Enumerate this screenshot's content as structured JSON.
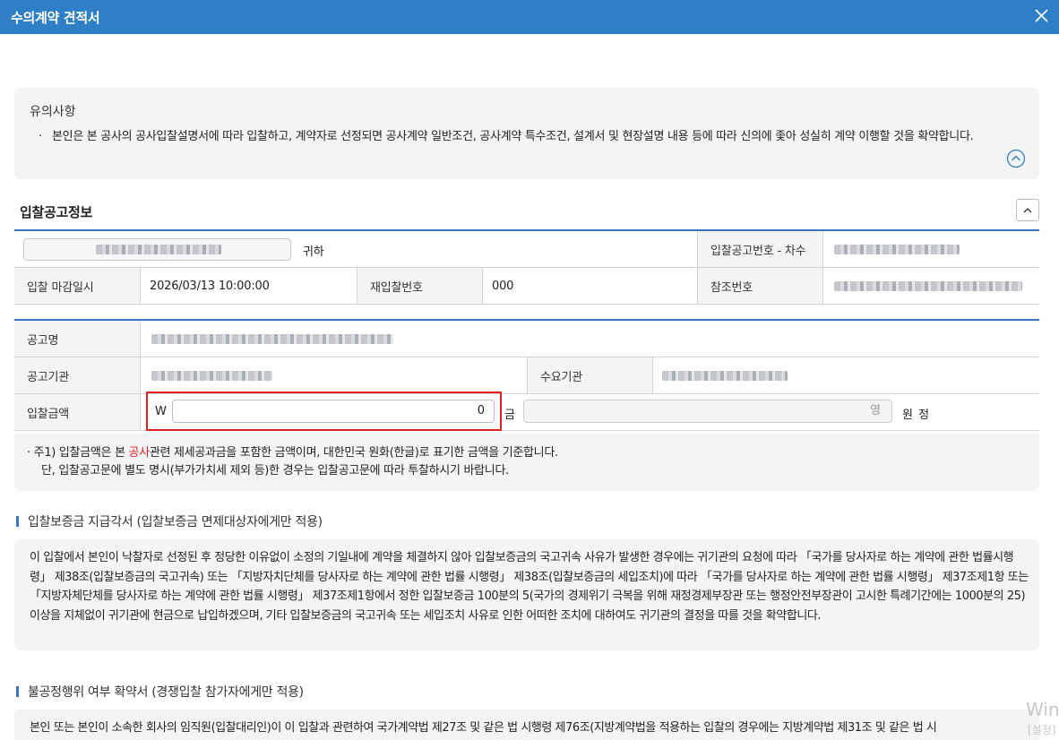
{
  "window": {
    "title": "수의계약 견적서",
    "close_icon": "close-icon"
  },
  "notice": {
    "title": "유의사항",
    "bullet": "·",
    "body": "본인은 본 공사의 공사입찰설명서에 따라 입찰하고, 계약자로 선정되면 공사계약 일반조건, 공사계약 특수조건, 설계서 및 현장설명 내용 등에 따라 신의에 좇아 성실히 계약 이행할 것을 확약합니다.",
    "toggle_icon": "chevron-up-circle-icon"
  },
  "bid_info": {
    "section_title": "입찰공고정보",
    "collapse_icon": "chevron-up-icon",
    "recipient_suffix": "귀하",
    "notice_number_label": "입찰공고번호 - 차수",
    "deadline_label": "입찰 마감일시",
    "deadline_value": "2026/03/13 10:00:00",
    "rebid_label": "재입찰번호",
    "rebid_value": "000",
    "ref_label": "참조번호"
  },
  "bid_form": {
    "name_label": "공고명",
    "agency_label": "공고기관",
    "demand_agency_label": "수요기관",
    "amount_label": "입찰금액",
    "currency_symbol": "W",
    "amount_value": "0",
    "korean_prefix": "금",
    "korean_value": "영",
    "korean_suffix": "원 정"
  },
  "note": {
    "line1_prefix": "· 주1) 입찰금액은 본 ",
    "line1_highlight": "공사",
    "line1_suffix": "관련 제세공과금을 포함한 금액이며, 대한민국 원화(한글)로 표기한 금액을 기준합니다.",
    "line2": "단, 입찰공고문에 별도 명시(부가가치세 제외 등)한 경우는 입찰공고문에 따라 투찰하시기 바랍니다."
  },
  "guarantee": {
    "title": "입찰보증금 지급각서 (입찰보증금 면제대상자에게만 적용)",
    "body": "이 입찰에서 본인이 낙찰자로 선정된 후 정당한 이유없이 소정의 기일내에 계약을 체결하지 않아 입찰보증금의 국고귀속 사유가 발생한 경우에는 귀기관의 요청에 따라 「국가를 당사자로 하는 계약에 관한 법률시행령」 제38조(입찰보증금의 국고귀속) 또는 「지방자치단체를 당사자로 하는 계약에 관한 법률 시행령」 제38조(입찰보증금의 세입조치)에 따라 「국가를 당사자로 하는 계약에 관한 법률 시행령」 제37조제1항 또는 「지방자체단체를 당사자로 하는 계약에 관한 법률 시행령」 제37조제1항에서 정한 입찰보증금 100분의 5(국가의 경제위기 극복을 위해 재정경제부장관 또는 행정안전부장관이 고시한 특례기간에는 1000분의 25) 이상을 지체없이 귀기관에 현금으로 납입하겠으며, 기타 입찰보증금의 국고귀속 또는 세입조치 사유로 인한 어떠한 조치에 대하여도 귀기관의 결정을 따를 것을 확약합니다."
  },
  "fair_trade": {
    "title": "불공정행위 여부 확약서 (경쟁입찰 참가자에게만 적용)",
    "body": "본인 또는 본인이 소속한 회사의 임직원(입찰대리인)이 이 입찰과 관련하여 국가계약법 제27조 및 같은 법 시행령 제76조(지방계약법을 적용하는 입찰의 경우에는 지방계약법 제31조 및 같은 법 시"
  },
  "watermark": {
    "line1": "Wind",
    "line2": "[설정]"
  },
  "colors": {
    "titlebar": "#2f7fc7",
    "table_border": "#3a73c4",
    "highlight": "#e02020"
  }
}
